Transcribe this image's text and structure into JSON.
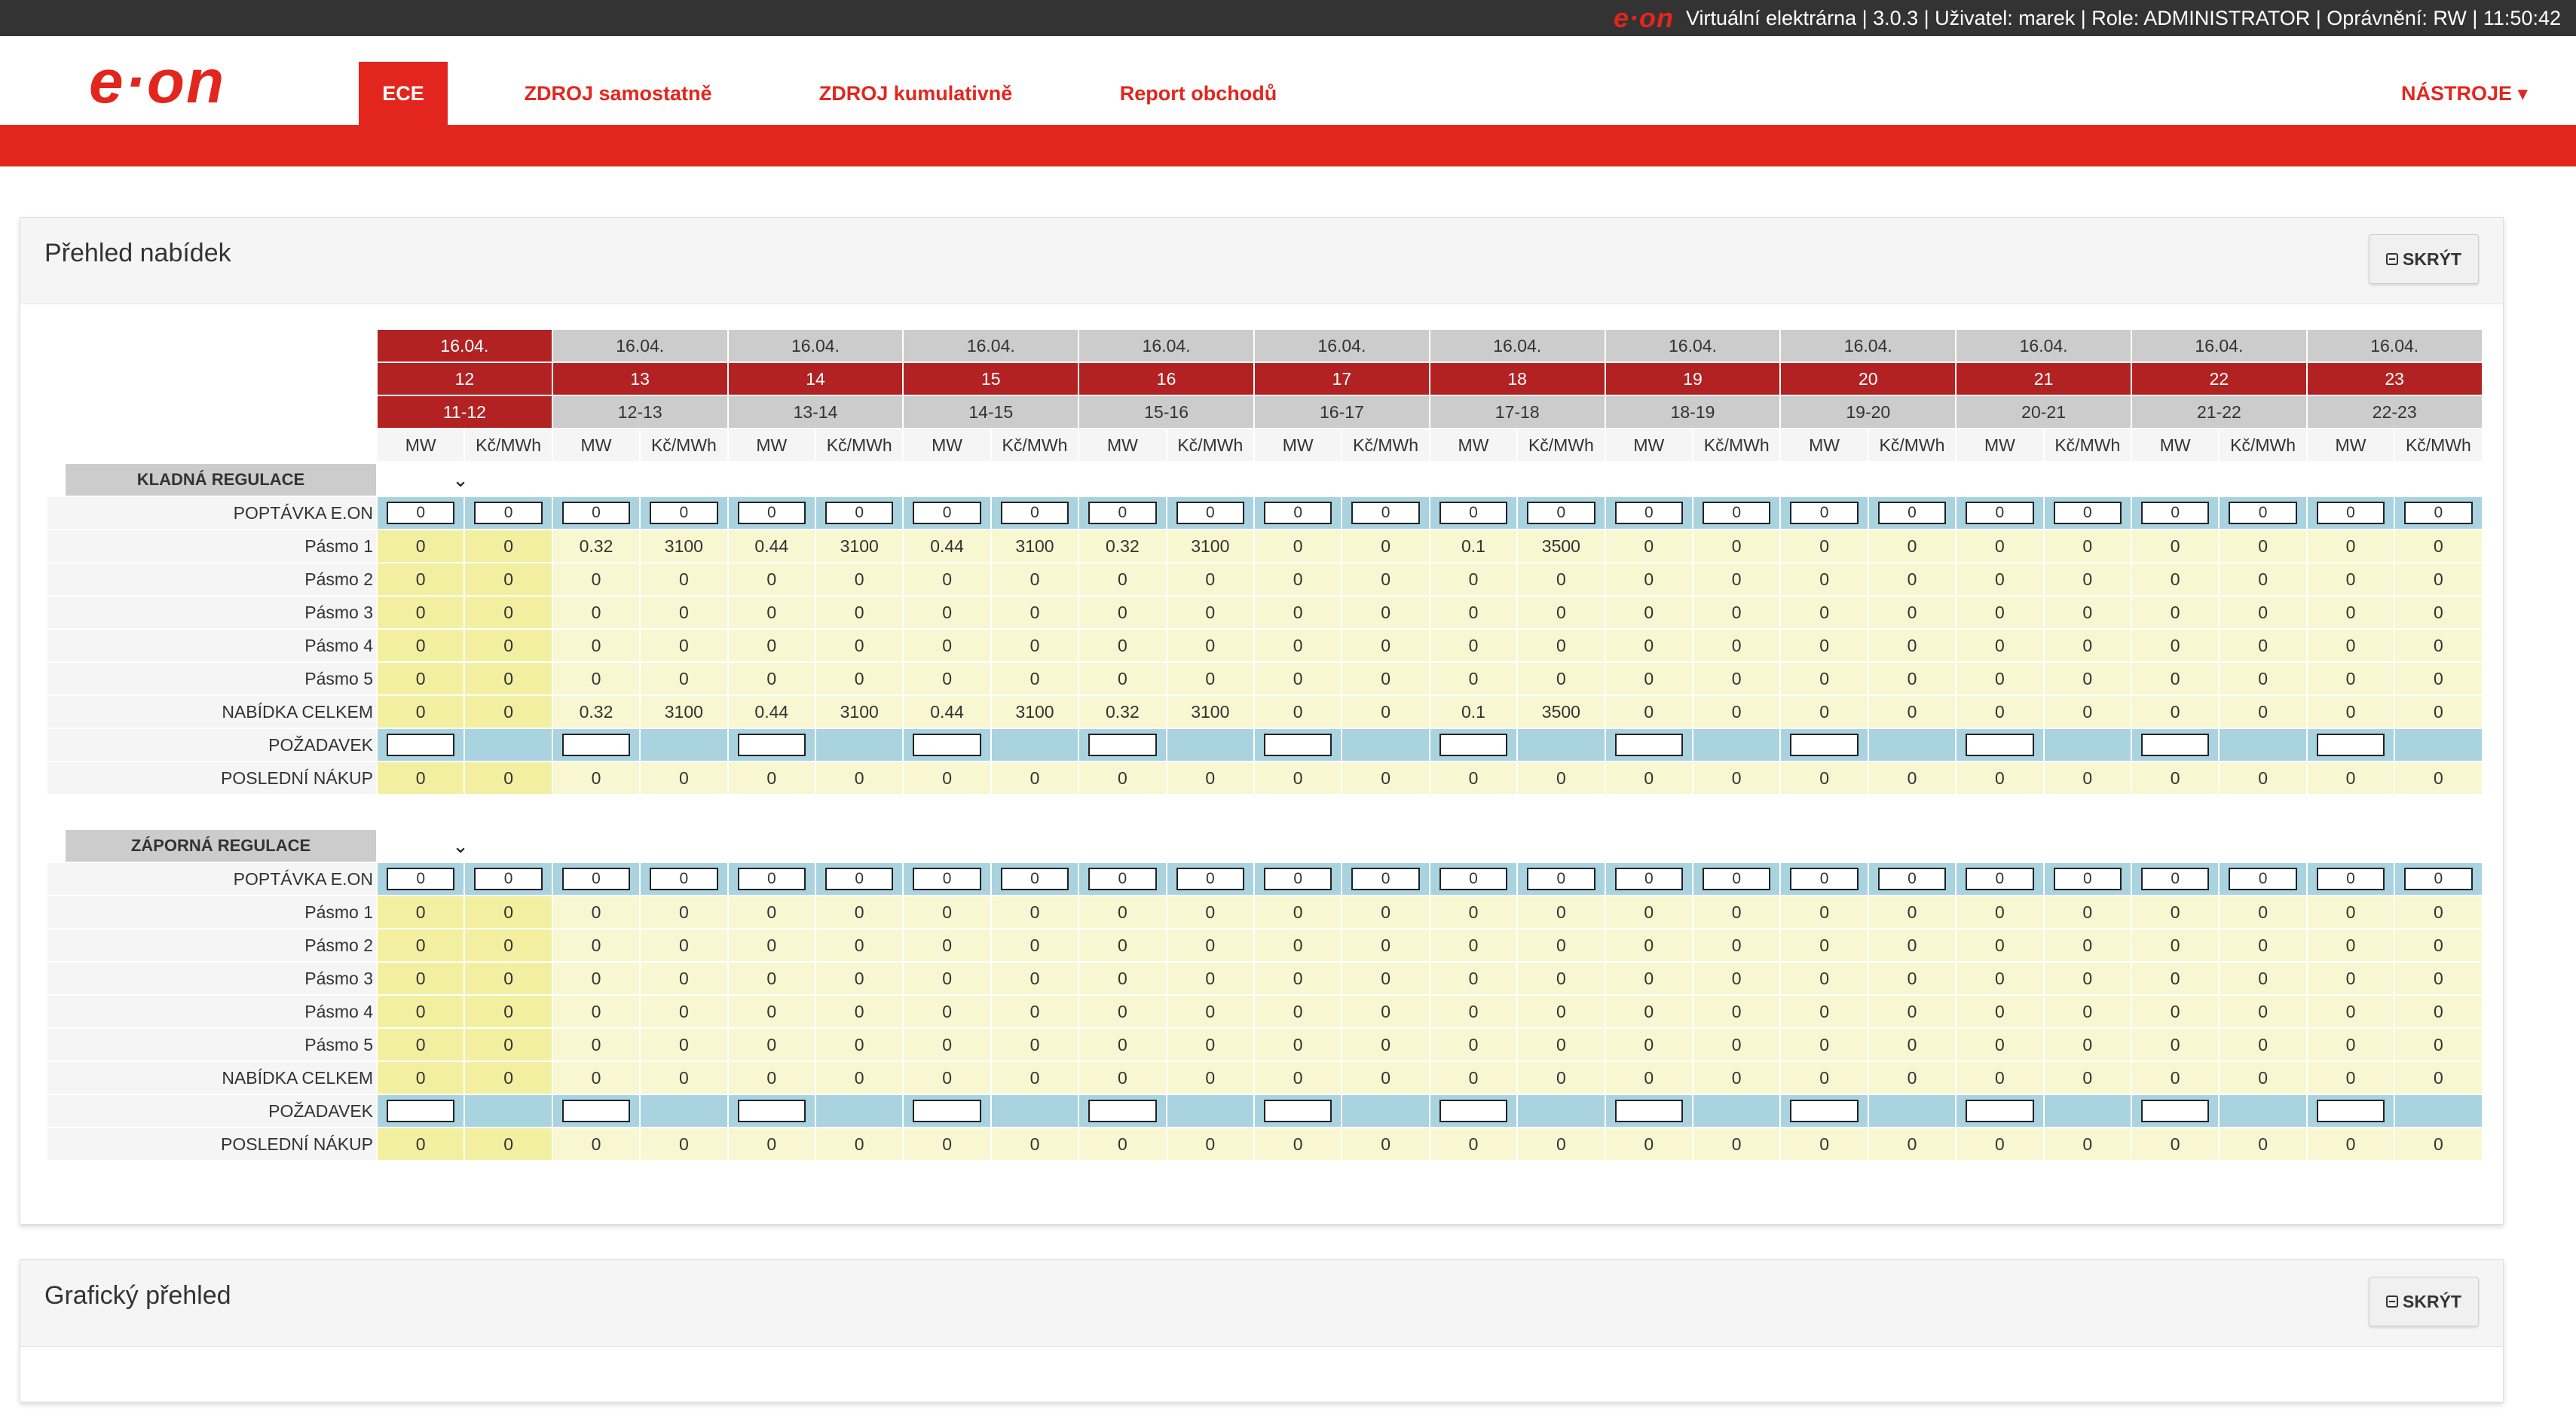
{
  "header": {
    "logo_text": "e·on",
    "info": "Virtuální elektrárna | 3.0.3 | Uživatel: marek | Role: ADMINISTRATOR | Oprávnění: RW | 11:50:42"
  },
  "nav": {
    "logo_text": "e·on",
    "items": [
      {
        "label": "ECE",
        "active": true
      },
      {
        "label": "ZDROJ samostatně",
        "active": false
      },
      {
        "label": "ZDROJ kumulativně",
        "active": false
      },
      {
        "label": "Report obchodů",
        "active": false
      }
    ],
    "tools_label": "NÁSTROJE ▾"
  },
  "offers_panel": {
    "title": "Přehled nabídek",
    "hide_label": "SKRÝT"
  },
  "graph_panel": {
    "title": "Grafický přehled",
    "hide_label": "SKRÝT"
  },
  "grid": {
    "dates": [
      "16.04.",
      "16.04.",
      "16.04.",
      "16.04.",
      "16.04.",
      "16.04.",
      "16.04.",
      "16.04.",
      "16.04.",
      "16.04.",
      "16.04.",
      "16.04."
    ],
    "hours": [
      "12",
      "13",
      "14",
      "15",
      "16",
      "17",
      "18",
      "19",
      "20",
      "21",
      "22",
      "23"
    ],
    "ranges": [
      "11-12",
      "12-13",
      "13-14",
      "14-15",
      "15-16",
      "16-17",
      "17-18",
      "18-19",
      "19-20",
      "20-21",
      "21-22",
      "22-23"
    ],
    "units": [
      "MW",
      "Kč/MWh"
    ],
    "sections": [
      {
        "title": "KLADNÁ REGULACE",
        "demand_label": "POPTÁVKA E.ON",
        "demand_value": "0",
        "bands": [
          {
            "label": "Pásmo 1",
            "values": [
              "0",
              "0",
              "0.32",
              "3100",
              "0.44",
              "3100",
              "0.44",
              "3100",
              "0.32",
              "3100",
              "0",
              "0",
              "0.1",
              "3500",
              "0",
              "0",
              "0",
              "0",
              "0",
              "0",
              "0",
              "0",
              "0",
              "0"
            ]
          },
          {
            "label": "Pásmo 2",
            "values": [
              "0",
              "0",
              "0",
              "0",
              "0",
              "0",
              "0",
              "0",
              "0",
              "0",
              "0",
              "0",
              "0",
              "0",
              "0",
              "0",
              "0",
              "0",
              "0",
              "0",
              "0",
              "0",
              "0",
              "0"
            ]
          },
          {
            "label": "Pásmo 3",
            "values": [
              "0",
              "0",
              "0",
              "0",
              "0",
              "0",
              "0",
              "0",
              "0",
              "0",
              "0",
              "0",
              "0",
              "0",
              "0",
              "0",
              "0",
              "0",
              "0",
              "0",
              "0",
              "0",
              "0",
              "0"
            ]
          },
          {
            "label": "Pásmo 4",
            "values": [
              "0",
              "0",
              "0",
              "0",
              "0",
              "0",
              "0",
              "0",
              "0",
              "0",
              "0",
              "0",
              "0",
              "0",
              "0",
              "0",
              "0",
              "0",
              "0",
              "0",
              "0",
              "0",
              "0",
              "0"
            ]
          },
          {
            "label": "Pásmo 5",
            "values": [
              "0",
              "0",
              "0",
              "0",
              "0",
              "0",
              "0",
              "0",
              "0",
              "0",
              "0",
              "0",
              "0",
              "0",
              "0",
              "0",
              "0",
              "0",
              "0",
              "0",
              "0",
              "0",
              "0",
              "0"
            ]
          },
          {
            "label": "NABÍDKA CELKEM",
            "values": [
              "0",
              "0",
              "0.32",
              "3100",
              "0.44",
              "3100",
              "0.44",
              "3100",
              "0.32",
              "3100",
              "0",
              "0",
              "0.1",
              "3500",
              "0",
              "0",
              "0",
              "0",
              "0",
              "0",
              "0",
              "0",
              "0",
              "0"
            ]
          }
        ],
        "request_label": "POŽADAVEK",
        "last_label": "POSLEDNÍ NÁKUP",
        "last_values": [
          "0",
          "0",
          "0",
          "0",
          "0",
          "0",
          "0",
          "0",
          "0",
          "0",
          "0",
          "0",
          "0",
          "0",
          "0",
          "0",
          "0",
          "0",
          "0",
          "0",
          "0",
          "0",
          "0",
          "0"
        ]
      },
      {
        "title": "ZÁPORNÁ REGULACE",
        "demand_label": "POPTÁVKA E.ON",
        "demand_value": "0",
        "bands": [
          {
            "label": "Pásmo 1",
            "values": [
              "0",
              "0",
              "0",
              "0",
              "0",
              "0",
              "0",
              "0",
              "0",
              "0",
              "0",
              "0",
              "0",
              "0",
              "0",
              "0",
              "0",
              "0",
              "0",
              "0",
              "0",
              "0",
              "0",
              "0"
            ]
          },
          {
            "label": "Pásmo 2",
            "values": [
              "0",
              "0",
              "0",
              "0",
              "0",
              "0",
              "0",
              "0",
              "0",
              "0",
              "0",
              "0",
              "0",
              "0",
              "0",
              "0",
              "0",
              "0",
              "0",
              "0",
              "0",
              "0",
              "0",
              "0"
            ]
          },
          {
            "label": "Pásmo 3",
            "values": [
              "0",
              "0",
              "0",
              "0",
              "0",
              "0",
              "0",
              "0",
              "0",
              "0",
              "0",
              "0",
              "0",
              "0",
              "0",
              "0",
              "0",
              "0",
              "0",
              "0",
              "0",
              "0",
              "0",
              "0"
            ]
          },
          {
            "label": "Pásmo 4",
            "values": [
              "0",
              "0",
              "0",
              "0",
              "0",
              "0",
              "0",
              "0",
              "0",
              "0",
              "0",
              "0",
              "0",
              "0",
              "0",
              "0",
              "0",
              "0",
              "0",
              "0",
              "0",
              "0",
              "0",
              "0"
            ]
          },
          {
            "label": "Pásmo 5",
            "values": [
              "0",
              "0",
              "0",
              "0",
              "0",
              "0",
              "0",
              "0",
              "0",
              "0",
              "0",
              "0",
              "0",
              "0",
              "0",
              "0",
              "0",
              "0",
              "0",
              "0",
              "0",
              "0",
              "0",
              "0"
            ]
          },
          {
            "label": "NABÍDKA CELKEM",
            "values": [
              "0",
              "0",
              "0",
              "0",
              "0",
              "0",
              "0",
              "0",
              "0",
              "0",
              "0",
              "0",
              "0",
              "0",
              "0",
              "0",
              "0",
              "0",
              "0",
              "0",
              "0",
              "0",
              "0",
              "0"
            ]
          }
        ],
        "request_label": "POŽADAVEK",
        "last_label": "POSLEDNÍ NÁKUP",
        "last_values": [
          "0",
          "0",
          "0",
          "0",
          "0",
          "0",
          "0",
          "0",
          "0",
          "0",
          "0",
          "0",
          "0",
          "0",
          "0",
          "0",
          "0",
          "0",
          "0",
          "0",
          "0",
          "0",
          "0",
          "0"
        ]
      }
    ]
  }
}
